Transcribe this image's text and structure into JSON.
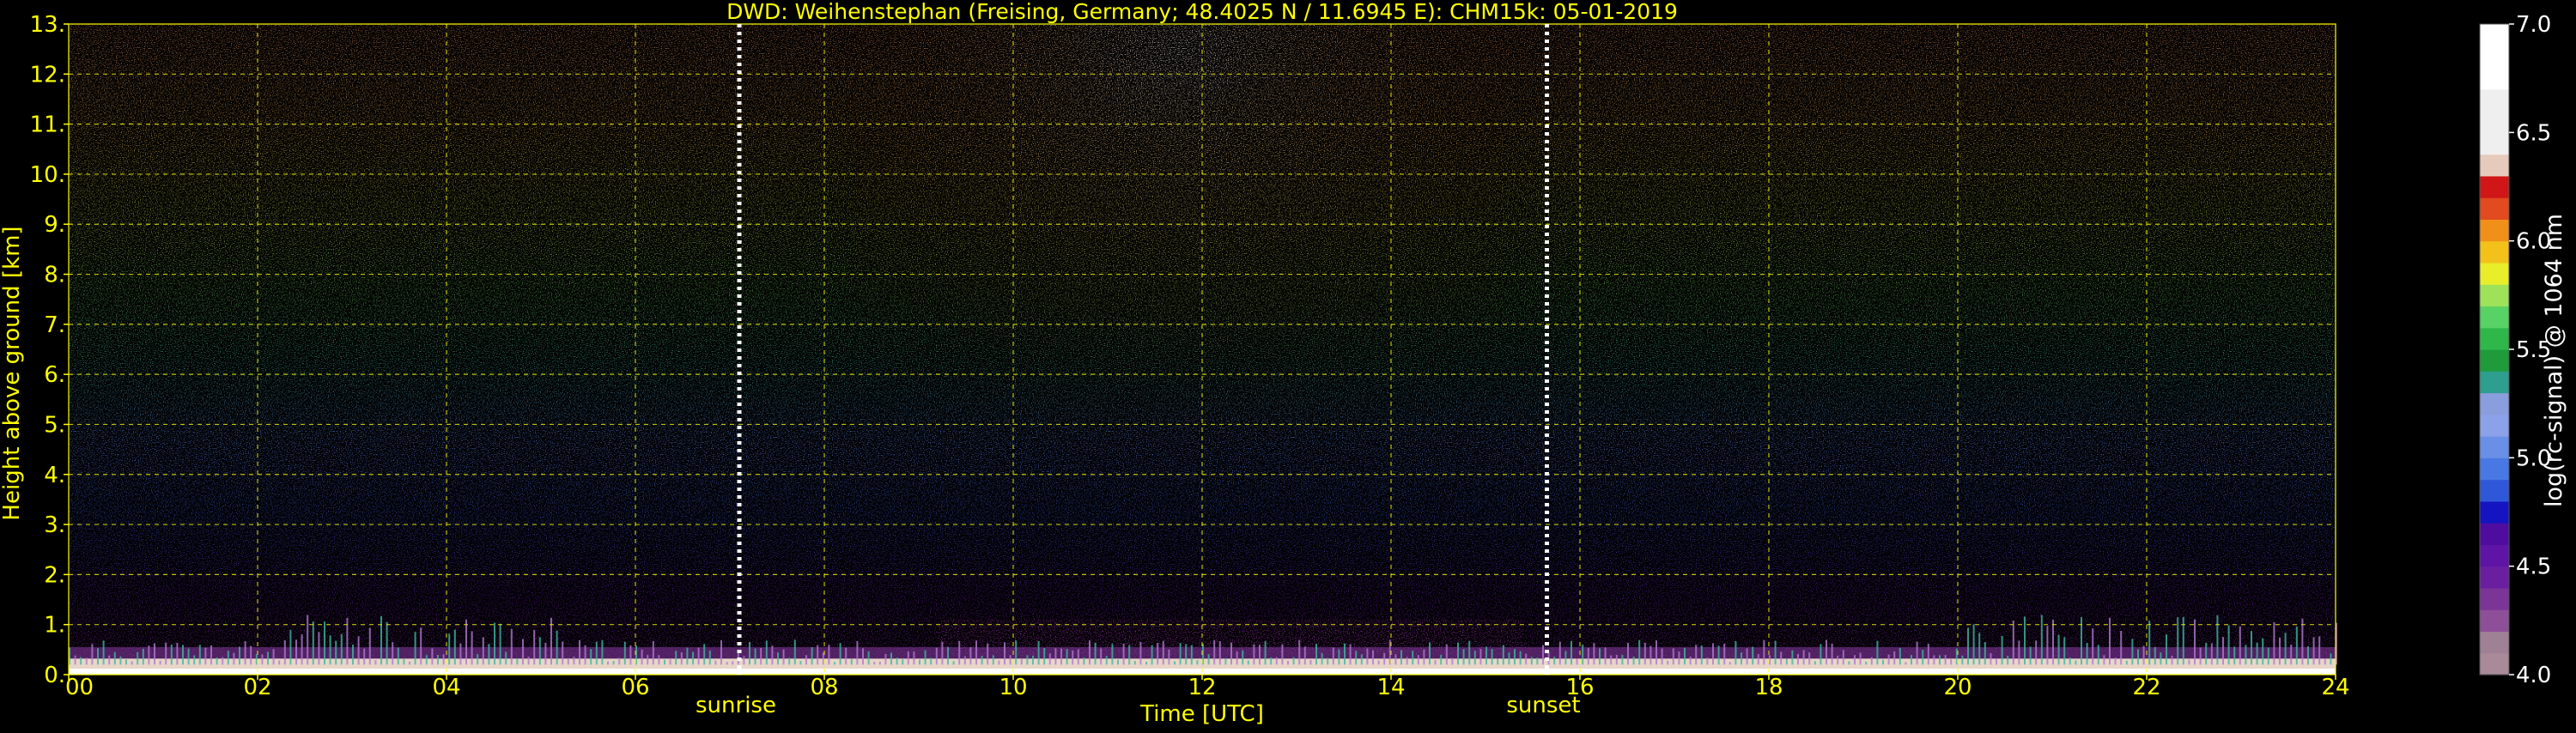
{
  "chart_data": {
    "type": "heatmap",
    "title": "DWD: Weihenstephan (Freising, Germany; 48.4025 N / 11.6945 E):    CHM15k: 05-01-2019",
    "xlabel": "Time [UTC]",
    "ylabel": "Height above ground [km]",
    "xlim": [
      0,
      24
    ],
    "ylim": [
      0,
      13
    ],
    "x_ticks": [
      {
        "value": 0,
        "label": "00"
      },
      {
        "value": 2,
        "label": "02"
      },
      {
        "value": 4,
        "label": "04"
      },
      {
        "value": 6,
        "label": "06"
      },
      {
        "value": 8,
        "label": "08"
      },
      {
        "value": 10,
        "label": "10"
      },
      {
        "value": 12,
        "label": "12"
      },
      {
        "value": 14,
        "label": "14"
      },
      {
        "value": 16,
        "label": "16"
      },
      {
        "value": 18,
        "label": "18"
      },
      {
        "value": 20,
        "label": "20"
      },
      {
        "value": 22,
        "label": "22"
      },
      {
        "value": 24,
        "label": "24"
      }
    ],
    "y_ticks": [
      {
        "value": 0,
        "label": "0."
      },
      {
        "value": 1,
        "label": "1."
      },
      {
        "value": 2,
        "label": "2."
      },
      {
        "value": 3,
        "label": "3."
      },
      {
        "value": 4,
        "label": "4."
      },
      {
        "value": 5,
        "label": "5."
      },
      {
        "value": 6,
        "label": "6."
      },
      {
        "value": 7,
        "label": "7."
      },
      {
        "value": 8,
        "label": "8."
      },
      {
        "value": 9,
        "label": "9."
      },
      {
        "value": 10,
        "label": "10."
      },
      {
        "value": 11,
        "label": "11."
      },
      {
        "value": 12,
        "label": "12."
      },
      {
        "value": 13,
        "label": "13."
      }
    ],
    "grid": true,
    "annotations": [
      {
        "label": "sunrise",
        "x": 7.1
      },
      {
        "label": "sunset",
        "x": 15.65
      }
    ],
    "colorbar": {
      "label": "log(rc-signal) @ 1064 nm",
      "range": [
        4.0,
        7.0
      ],
      "ticks": [
        {
          "value": 4.0,
          "label": "4.0"
        },
        {
          "value": 4.5,
          "label": "4.5"
        },
        {
          "value": 5.0,
          "label": "5.0"
        },
        {
          "value": 5.5,
          "label": "5.5"
        },
        {
          "value": 6.0,
          "label": "6.0"
        },
        {
          "value": 6.5,
          "label": "6.5"
        },
        {
          "value": 7.0,
          "label": "7.0"
        }
      ],
      "bands": [
        {
          "from": 4.0,
          "to": 4.1,
          "color": "#a98a98"
        },
        {
          "from": 4.1,
          "to": 4.2,
          "color": "#9f8195"
        },
        {
          "from": 4.2,
          "to": 4.3,
          "color": "#8e4f99"
        },
        {
          "from": 4.3,
          "to": 4.4,
          "color": "#7b3596"
        },
        {
          "from": 4.4,
          "to": 4.5,
          "color": "#6a1fa0"
        },
        {
          "from": 4.5,
          "to": 4.6,
          "color": "#5e14a5"
        },
        {
          "from": 4.6,
          "to": 4.7,
          "color": "#4e0d9e"
        },
        {
          "from": 4.7,
          "to": 4.8,
          "color": "#1414c0"
        },
        {
          "from": 4.8,
          "to": 4.9,
          "color": "#2e58d8"
        },
        {
          "from": 4.9,
          "to": 5.0,
          "color": "#4878e4"
        },
        {
          "from": 5.0,
          "to": 5.1,
          "color": "#6a8fe6"
        },
        {
          "from": 5.1,
          "to": 5.2,
          "color": "#8ba2e8"
        },
        {
          "from": 5.2,
          "to": 5.3,
          "color": "#8a9ddc"
        },
        {
          "from": 5.3,
          "to": 5.4,
          "color": "#2e9e8e"
        },
        {
          "from": 5.4,
          "to": 5.5,
          "color": "#1f9b3c"
        },
        {
          "from": 5.5,
          "to": 5.6,
          "color": "#2fb849"
        },
        {
          "from": 5.6,
          "to": 5.7,
          "color": "#58d264"
        },
        {
          "from": 5.7,
          "to": 5.8,
          "color": "#9ee25a"
        },
        {
          "from": 5.8,
          "to": 5.9,
          "color": "#e9ee2a"
        },
        {
          "from": 5.9,
          "to": 6.0,
          "color": "#f2c21a"
        },
        {
          "from": 6.0,
          "to": 6.1,
          "color": "#f09019"
        },
        {
          "from": 6.1,
          "to": 6.2,
          "color": "#e24a20"
        },
        {
          "from": 6.2,
          "to": 6.3,
          "color": "#d01616"
        },
        {
          "from": 6.3,
          "to": 6.4,
          "color": "#e6cbbd"
        },
        {
          "from": 6.4,
          "to": 6.7,
          "color": "#efefef"
        },
        {
          "from": 6.7,
          "to": 7.0,
          "color": "#ffffff"
        }
      ]
    },
    "colors": {
      "axis_text": "#ffff00",
      "grid": "#ffff00",
      "colorbar_text": "#ffffff",
      "background": "#000000",
      "marker_line": "#ffffff"
    }
  }
}
